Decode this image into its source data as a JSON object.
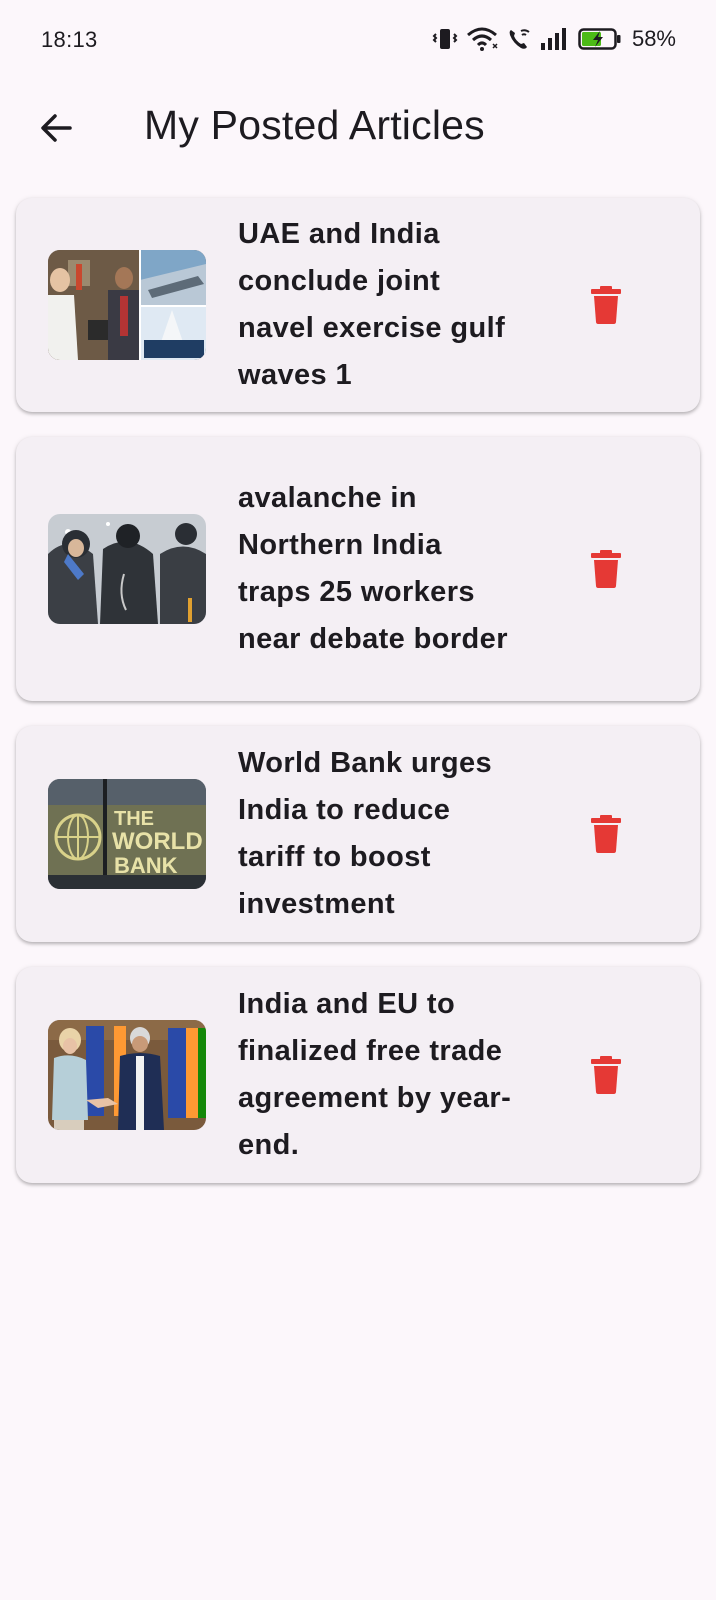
{
  "status_bar": {
    "time": "18:13",
    "battery_percent": "58%",
    "icons": [
      "vibrate-icon",
      "wifi-icon",
      "wifi-call-icon",
      "signal-icon",
      "battery-charging-icon"
    ]
  },
  "app_bar": {
    "back_icon": "arrow-back-icon",
    "title": "My Posted Articles"
  },
  "colors": {
    "background": "#fcf7fb",
    "card": "#f4eff4",
    "delete_icon": "#e53935",
    "text": "#1d1b20"
  },
  "articles": [
    {
      "title": "UAE and India conclude joint navel exercise gulf waves 1",
      "delete_icon": "delete-icon"
    },
    {
      "title": "avalanche in Northern India traps 25 workers near debate border",
      "delete_icon": "delete-icon"
    },
    {
      "title": "World Bank urges India to reduce tariff to boost investment",
      "delete_icon": "delete-icon",
      "thumbnail_text": [
        "THE",
        "WORLD",
        "BANK"
      ]
    },
    {
      "title": "India and EU to finalized free trade agreement by year-end.",
      "delete_icon": "delete-icon"
    }
  ]
}
